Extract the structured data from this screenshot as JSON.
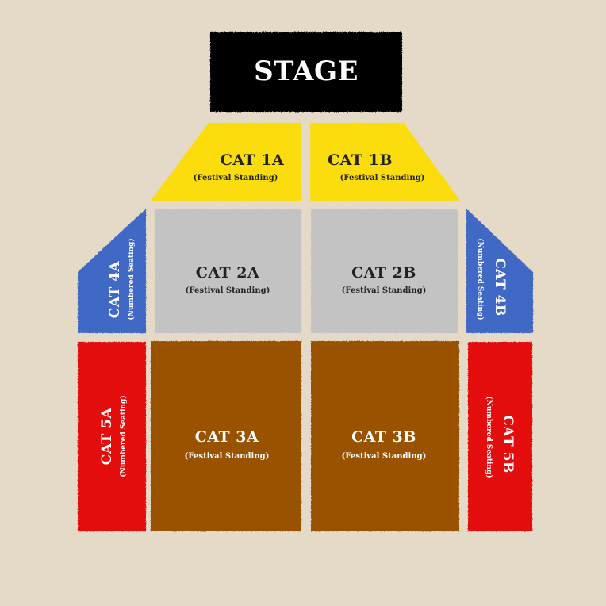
{
  "stage": {
    "label": "STAGE"
  },
  "sections": {
    "cat1a": {
      "label": "CAT 1A",
      "type": "(Festival Standing)",
      "color": "#fbdd0a"
    },
    "cat1b": {
      "label": "CAT 1B",
      "type": "(Festival Standing)",
      "color": "#fbdd0a"
    },
    "cat2a": {
      "label": "CAT 2A",
      "type": "(Festival Standing)",
      "color": "#c3c3c3"
    },
    "cat2b": {
      "label": "CAT 2B",
      "type": "(Festival Standing)",
      "color": "#c3c3c3"
    },
    "cat3a": {
      "label": "CAT 3A",
      "type": "(Festival Standing)",
      "color": "#995300"
    },
    "cat3b": {
      "label": "CAT 3B",
      "type": "(Festival Standing)",
      "color": "#995300"
    },
    "cat4a": {
      "label": "CAT 4A",
      "type": "(Numbered Seating)",
      "color": "#4069c6"
    },
    "cat4b": {
      "label": "CAT 4B",
      "type": "(Numbered Seating)",
      "color": "#4069c6"
    },
    "cat5a": {
      "label": "CAT 5A",
      "type": "(Numbered Seating)",
      "color": "#e30b0b"
    },
    "cat5b": {
      "label": "CAT 5B",
      "type": "(Numbered Seating)",
      "color": "#e30b0b"
    }
  }
}
